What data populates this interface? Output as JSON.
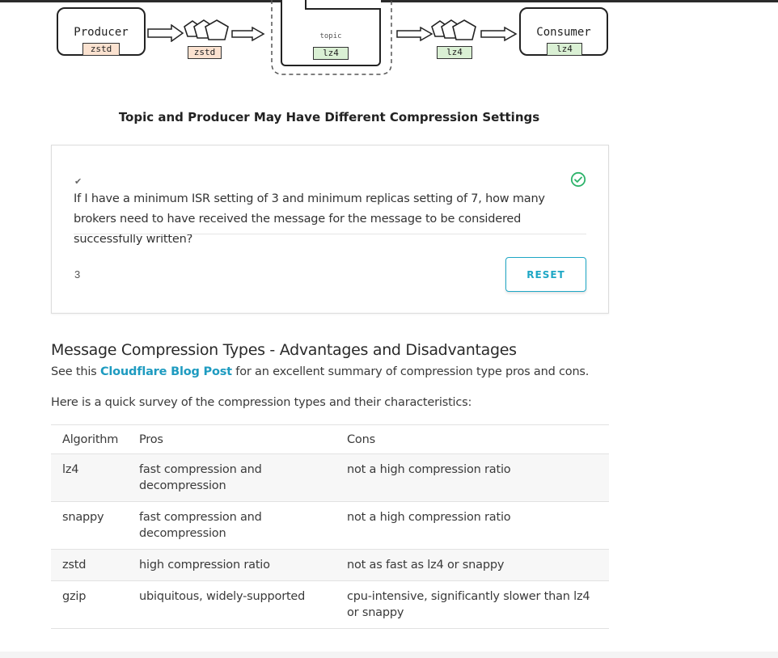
{
  "diagram": {
    "producer_label": "Producer",
    "producer_codec": "zstd",
    "batch1_codec": "zstd",
    "topic_label": "topic",
    "topic_codec": "lz4",
    "batch2_codec": "lz4",
    "consumer_label": "Consumer",
    "consumer_codec": "lz4",
    "colors": {
      "zstd": "#fbe2d0",
      "lz4": "#daf0d4"
    }
  },
  "caption": "Topic and Producer May Have Different Compression Settings",
  "quiz": {
    "check_mark": "✔",
    "question": "If I have a minimum ISR setting of 3 and minimum replicas setting of 7, how many brokers need to have received the message for the message to be considered successfully written?",
    "answer": "3",
    "reset_label": "RESET",
    "status_icon": "check-circle-icon",
    "accent": "#1ea7c5",
    "success_color": "#2db36a"
  },
  "section": {
    "title": "Message Compression Types - Advantages and Disadvantages",
    "intro_prefix": "See this ",
    "intro_link": "Cloudflare Blog Post",
    "intro_suffix": " for an excellent summary of compression type pros and cons.",
    "survey": "Here is a quick survey of the compression types and their characteristics:"
  },
  "table": {
    "headers": [
      "Algorithm",
      "Pros",
      "Cons"
    ],
    "rows": [
      {
        "algorithm": "lz4",
        "pros": "fast compression and decompression",
        "cons": "not a high compression ratio"
      },
      {
        "algorithm": "snappy",
        "pros": "fast compression and decompression",
        "cons": "not a high compression ratio"
      },
      {
        "algorithm": "zstd",
        "pros": "high compression ratio",
        "cons": "not as fast as lz4 or snappy"
      },
      {
        "algorithm": "gzip",
        "pros": "ubiquitous, widely-supported",
        "cons": "cpu-intensive, significantly slower than lz4 or snappy"
      }
    ]
  }
}
